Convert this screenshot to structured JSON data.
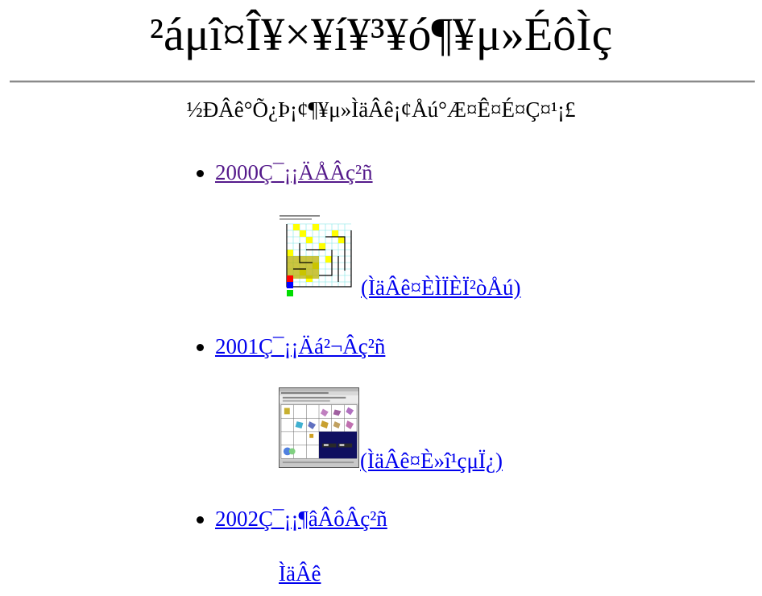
{
  "page": {
    "title": "²áμî¤Î¥×¥í¥³¥ó¶¥μ»ÉôÌç",
    "intro": "½ÐÂê°Õ¿Þ¡¢¶¥μ»ÌäÂê¡¢Åú°Æ¤Ê¤É¤Ç¤¹¡£"
  },
  "items": [
    {
      "label": "2000Ç¯¡¡ÄÅÂç²ñ",
      "visited": true,
      "sub_link": "(ÌäÂê¤ÈÌÏÈÏ²òÅú)",
      "thumbnail": "maze-grid-screenshot"
    },
    {
      "label": "2001Ç¯¡¡Äá²¬Âç²ñ",
      "visited": false,
      "sub_link": "(ÌäÂê¤È»î¹çμÏ¿)",
      "thumbnail": "application-window-screenshot"
    },
    {
      "label": "2002Ç¯¡¡¶âÂôÂç²ñ",
      "visited": false,
      "sub_link": "ÌäÂê"
    }
  ],
  "colors": {
    "link": "#0000ee",
    "visited_link": "#551a8b",
    "rule": "#8a8a8a"
  }
}
